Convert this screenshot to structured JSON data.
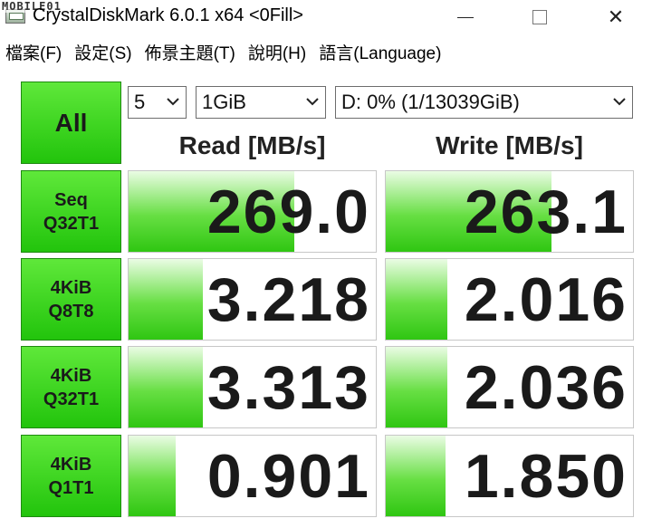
{
  "window": {
    "title": "CrystalDiskMark 6.0.1 x64 <0Fill>",
    "watermark": "MOBILE01",
    "controls": {
      "minimize": "minimize",
      "maximize": "maximize",
      "close": "✕"
    }
  },
  "menu": [
    {
      "label": "檔案(F)"
    },
    {
      "label": "設定(S)"
    },
    {
      "label": "佈景主題(T)"
    },
    {
      "label": "說明(H)"
    },
    {
      "label": "語言(Language)"
    }
  ],
  "controls": {
    "all_label": "All",
    "count": "5",
    "size": "1GiB",
    "drive": "D: 0% (1/13039GiB)"
  },
  "headers": {
    "read": "Read [MB/s]",
    "write": "Write [MB/s]"
  },
  "tests": [
    {
      "line1": "Seq",
      "line2": "Q32T1",
      "read": "269.0",
      "write": "263.1",
      "read_fill": 0.67,
      "write_fill": 0.67
    },
    {
      "line1": "4KiB",
      "line2": "Q8T8",
      "read": "3.218",
      "write": "2.016",
      "read_fill": 0.3,
      "write_fill": 0.25
    },
    {
      "line1": "4KiB",
      "line2": "Q32T1",
      "read": "3.313",
      "write": "2.036",
      "read_fill": 0.3,
      "write_fill": 0.25
    },
    {
      "line1": "4KiB",
      "line2": "Q1T1",
      "read": "0.901",
      "write": "1.850",
      "read_fill": 0.19,
      "write_fill": 0.24
    }
  ],
  "colors": {
    "accent_green": "#3ad21c",
    "border": "#c7c7c7"
  },
  "icons": {
    "app": "disk-app-icon",
    "dropdown": "chevron-down-icon"
  }
}
